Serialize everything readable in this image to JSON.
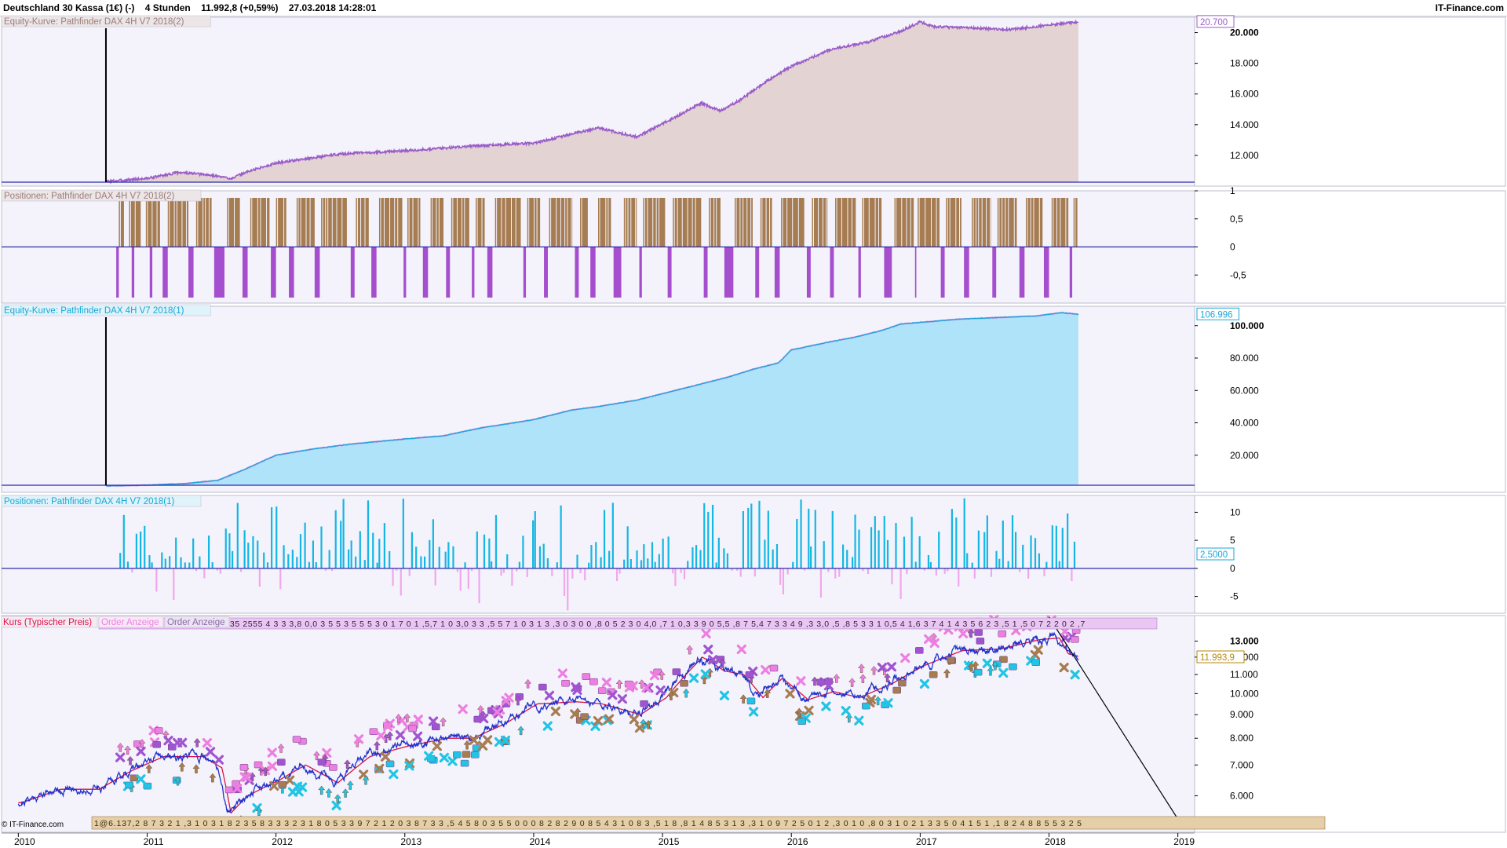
{
  "header": {
    "instrument": "Deutschland 30 Kassa (1€) (-)",
    "timeframe": "4 Stunden",
    "last_price": "11.992,8 (+0,59%)",
    "timestamp": "27.03.2018 14:28:01",
    "brand": "IT-Finance.com"
  },
  "footer": {
    "copyright": "© IT-Finance.com"
  },
  "colors": {
    "panel_bg": "#f4f3fb",
    "equity2_line": "#9a5cc8",
    "equity2_fill": "#e3d3d3",
    "pos2_long": "#a67c52",
    "pos2_short": "#a54fcf",
    "equity1_line": "#1aa6d8",
    "equity1_fill": "#aee3fa",
    "pos1_long": "#14b6e4",
    "pos1_short": "#f2a6ec",
    "price_blue": "#2233cc",
    "price_red": "#dd1144",
    "marker_purple": "#a054d0",
    "marker_pink": "#ec7fe0",
    "marker_brown": "#a67c52",
    "marker_cyan": "#22c4e4",
    "zero_line": "#2a2aaa",
    "trend_line": "#000000"
  },
  "chart_data": [
    {
      "type": "area",
      "title": "Equity-Kurve: Pathfinder DAX 4H V7 2018(2)",
      "current_value_label": "20.700",
      "y_ticks": [
        "12.000",
        "14.000",
        "16.000",
        "18.000",
        "20.000"
      ],
      "ylim": [
        10000,
        21000
      ],
      "x": [
        2010.68,
        2011.0,
        2011.25,
        2011.5,
        2011.65,
        2011.8,
        2012.0,
        2012.5,
        2013.0,
        2013.5,
        2014.0,
        2014.5,
        2014.8,
        2015.1,
        2015.3,
        2015.45,
        2015.6,
        2015.8,
        2016.0,
        2016.3,
        2016.6,
        2016.85,
        2017.0,
        2017.1,
        2017.4,
        2017.7,
        2018.0,
        2018.23
      ],
      "y": [
        10300,
        10500,
        10900,
        10700,
        10500,
        11000,
        11500,
        12100,
        12300,
        12600,
        12800,
        13800,
        13200,
        14500,
        15400,
        14900,
        15600,
        16800,
        17800,
        18900,
        19400,
        20100,
        20700,
        20400,
        20300,
        20200,
        20500,
        20700
      ]
    },
    {
      "type": "bar",
      "title": "Positionen: Pathfinder DAX 4H V7 2018(2)",
      "y_ticks": [
        "1",
        "0,5",
        "0",
        "-0,5"
      ],
      "ylim": [
        -1,
        1
      ],
      "long_value": 1,
      "short_value": -1,
      "long_intervals": [
        [
          2010.78,
          2010.82
        ],
        [
          2010.86,
          2010.95
        ],
        [
          2010.99,
          2011.1
        ],
        [
          2011.16,
          2011.32
        ],
        [
          2011.38,
          2011.5
        ],
        [
          2011.62,
          2011.72
        ],
        [
          2011.8,
          2011.95
        ],
        [
          2012.0,
          2012.08
        ],
        [
          2012.16,
          2012.3
        ],
        [
          2012.35,
          2012.55
        ],
        [
          2012.62,
          2012.72
        ],
        [
          2012.8,
          2012.98
        ],
        [
          2013.02,
          2013.12
        ],
        [
          2013.2,
          2013.3
        ],
        [
          2013.36,
          2013.5
        ],
        [
          2013.55,
          2013.62
        ],
        [
          2013.7,
          2013.9
        ],
        [
          2013.95,
          2014.05
        ],
        [
          2014.12,
          2014.3
        ],
        [
          2014.36,
          2014.42
        ],
        [
          2014.5,
          2014.6
        ],
        [
          2014.7,
          2014.8
        ],
        [
          2014.85,
          2015.02
        ],
        [
          2015.08,
          2015.3
        ],
        [
          2015.36,
          2015.45
        ],
        [
          2015.56,
          2015.7
        ],
        [
          2015.76,
          2015.85
        ],
        [
          2015.92,
          2016.1
        ],
        [
          2016.16,
          2016.28
        ],
        [
          2016.34,
          2016.5
        ],
        [
          2016.55,
          2016.7
        ],
        [
          2016.8,
          2016.95
        ],
        [
          2016.98,
          2017.15
        ],
        [
          2017.2,
          2017.32
        ],
        [
          2017.4,
          2017.55
        ],
        [
          2017.6,
          2017.75
        ],
        [
          2017.82,
          2017.95
        ],
        [
          2018.02,
          2018.15
        ],
        [
          2018.19,
          2018.22
        ]
      ],
      "short_intervals": [
        [
          2010.76,
          2010.78
        ],
        [
          2010.88,
          2010.9
        ],
        [
          2011.02,
          2011.04
        ],
        [
          2011.12,
          2011.16
        ],
        [
          2011.32,
          2011.36
        ],
        [
          2011.52,
          2011.6
        ],
        [
          2011.74,
          2011.78
        ],
        [
          2011.96,
          2012.0
        ],
        [
          2012.1,
          2012.14
        ],
        [
          2012.3,
          2012.34
        ],
        [
          2012.58,
          2012.61
        ],
        [
          2012.74,
          2012.78
        ],
        [
          2012.99,
          2013.01
        ],
        [
          2013.14,
          2013.18
        ],
        [
          2013.32,
          2013.35
        ],
        [
          2013.52,
          2013.54
        ],
        [
          2013.64,
          2013.68
        ],
        [
          2013.92,
          2013.94
        ],
        [
          2014.08,
          2014.11
        ],
        [
          2014.32,
          2014.35
        ],
        [
          2014.44,
          2014.48
        ],
        [
          2014.62,
          2014.68
        ],
        [
          2014.82,
          2014.84
        ],
        [
          2015.04,
          2015.07
        ],
        [
          2015.32,
          2015.35
        ],
        [
          2015.48,
          2015.55
        ],
        [
          2015.72,
          2015.75
        ],
        [
          2015.87,
          2015.91
        ],
        [
          2016.12,
          2016.15
        ],
        [
          2016.3,
          2016.33
        ],
        [
          2016.52,
          2016.54
        ],
        [
          2016.72,
          2016.78
        ],
        [
          2016.96,
          2016.97
        ],
        [
          2017.16,
          2017.19
        ],
        [
          2017.34,
          2017.38
        ],
        [
          2017.56,
          2017.59
        ],
        [
          2017.77,
          2017.81
        ],
        [
          2017.96,
          2018.0
        ],
        [
          2018.16,
          2018.18
        ]
      ]
    },
    {
      "type": "area",
      "title": "Equity-Kurve: Pathfinder DAX 4H V7 2018(1)",
      "current_value_label": "106.996",
      "y_ticks": [
        "20.000",
        "40.000",
        "60.000",
        "80.000",
        "100.000"
      ],
      "ylim": [
        0,
        112000
      ],
      "x": [
        2010.68,
        2011.0,
        2011.3,
        2011.55,
        2011.75,
        2012.0,
        2012.3,
        2012.6,
        2013.0,
        2013.3,
        2013.6,
        2013.85,
        2014.0,
        2014.3,
        2014.5,
        2014.8,
        2015.0,
        2015.3,
        2015.5,
        2015.7,
        2015.9,
        2016.0,
        2016.3,
        2016.5,
        2016.7,
        2016.85,
        2017.0,
        2017.3,
        2017.6,
        2017.9,
        2018.1,
        2018.23
      ],
      "y": [
        1000,
        1500,
        2500,
        4500,
        11000,
        20000,
        24000,
        27000,
        30000,
        32000,
        37000,
        40000,
        42000,
        48000,
        50000,
        54000,
        58000,
        64000,
        68000,
        73000,
        77000,
        85000,
        90000,
        93000,
        97000,
        101000,
        102000,
        104000,
        105000,
        106000,
        108000,
        106996
      ]
    },
    {
      "type": "bar",
      "title": "Positionen: Pathfinder DAX 4H V7 2018(1)",
      "current_value_label": "2,5000",
      "y_ticks": [
        "10",
        "5",
        "0",
        "-5"
      ],
      "ylim": [
        -8,
        13
      ],
      "seed": 11,
      "x_range": [
        2010.78,
        2018.22
      ],
      "bar_count": 240
    },
    {
      "type": "line",
      "title": "Kurs (Typischer Preis)",
      "legend": [
        "Kurs (Typischer Preis)",
        "Order Anzeige",
        "Order Anzeige"
      ],
      "current_value_label": "11.993,9",
      "y_ticks": [
        "6.000",
        "7.000",
        "8.000",
        "9.000",
        "10.000",
        "11.000",
        "12.000",
        "13.000"
      ],
      "ylim": [
        5000,
        14200
      ],
      "log_scale": true,
      "x": [
        2010.0,
        2010.3,
        2010.6,
        2010.85,
        2011.1,
        2011.4,
        2011.55,
        2011.62,
        2011.75,
        2012.0,
        2012.2,
        2012.45,
        2012.7,
        2013.0,
        2013.3,
        2013.5,
        2013.75,
        2014.0,
        2014.3,
        2014.5,
        2014.8,
        2015.0,
        2015.28,
        2015.45,
        2015.6,
        2015.75,
        2015.9,
        2016.1,
        2016.3,
        2016.5,
        2016.75,
        2017.0,
        2017.3,
        2017.6,
        2017.9,
        2018.05,
        2018.12,
        2018.23
      ],
      "y": [
        5800,
        6200,
        6200,
        6800,
        7300,
        7300,
        6900,
        5500,
        6000,
        6500,
        7000,
        6400,
        7300,
        7700,
        8000,
        8000,
        8600,
        9500,
        9600,
        9500,
        9000,
        9800,
        12000,
        11200,
        11000,
        9800,
        10800,
        9700,
        10100,
        9800,
        10500,
        11500,
        12400,
        12500,
        13100,
        13200,
        12200,
        11990
      ],
      "x_ticks": [
        "2010",
        "2011",
        "2012",
        "2013",
        "2014",
        "2015",
        "2016",
        "2017",
        "2018",
        "2019"
      ],
      "x_tick_years": [
        2010,
        2011,
        2012,
        2013,
        2014,
        2015,
        2016,
        2017,
        2018,
        2019
      ],
      "x_range": [
        2009.87,
        2019.13
      ],
      "order_strip_top": "2135 2555 4 3 3 3,8 0,0 3 5 5 3 5 5 5 3 0 1 7 0 1 ,5,7 1 0 3,0 3 3 ,5 5 7 1 0 3 1 3 ,3 0 3 0 0 ,8 0 5 2 3 0 4,0 ,7 1 0,3 3 9 0 5,5 ,8 7 5,4 7 3 3 4 9 ,3 3,0 ,5 ,8 5 3 3 1 0,5 4 1,6 3 7 4 1 4 3 5 6 2 3 ,5 1 ,5 0 7 2 2 0 2 ,7",
      "order_strip_bottom": "1@6.137,2 8 7 3 2 1 ,3 1 0 3 1 8 2 3 5 8 3 3 3 2 3 1 8 0 5 3 3 9 7 2 1 2 0 3 8 7 3 3 ,5 4 5 8 0 3 5 5 0 0 0 8 2 8 2 9 0 8 5 4 3 1 0 8 3 ,5 1 8 ,8 1 4 8 5 3 1 3 ,3 1 0 9 7 2 5 0 1 2 ,3 0 1 0 ,8 0 3 1 0 2 1 3 3 5 0 4 1 5 1 ,1 8 2 4 8 8 5 5 3 2 5"
    }
  ]
}
